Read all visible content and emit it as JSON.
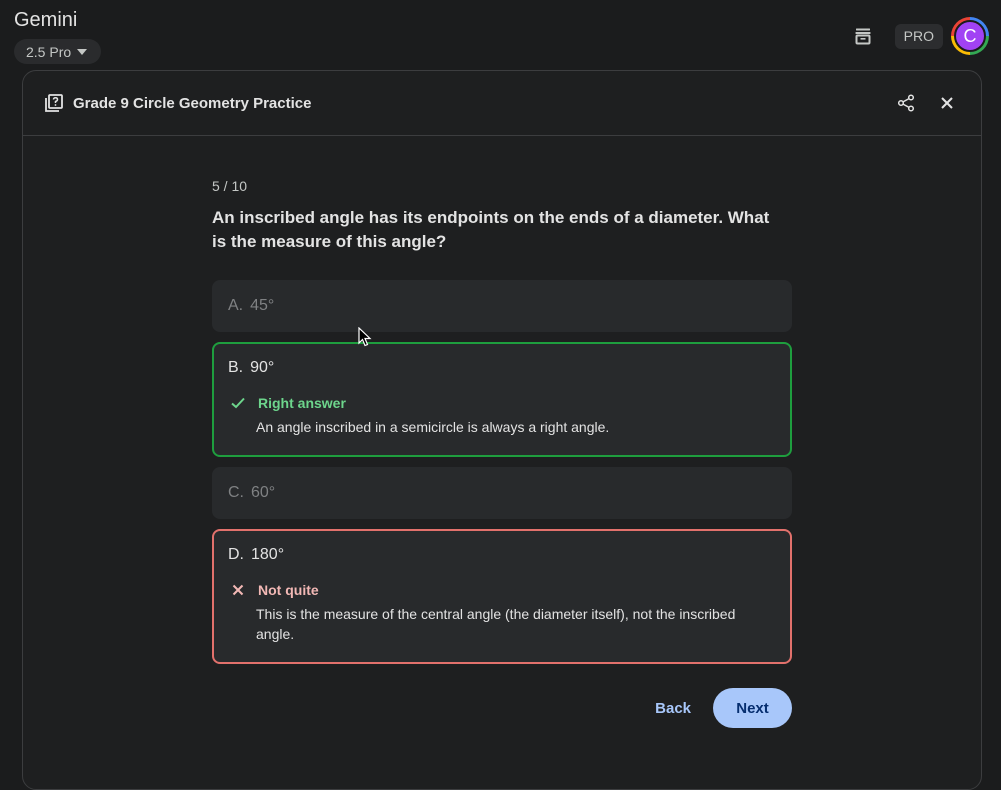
{
  "app": {
    "title": "Gemini",
    "model": "2.5 Pro",
    "pro_badge": "PRO",
    "avatar_letter": "C"
  },
  "panel": {
    "title": "Grade 9 Circle Geometry Practice"
  },
  "quiz": {
    "progress": "5 / 10",
    "question": "An inscribed angle has its endpoints on the ends of a diameter. What is the measure of this angle?",
    "options": [
      {
        "letter": "A.",
        "text": "45°"
      },
      {
        "letter": "B.",
        "text": "90°",
        "feedback_title": "Right answer",
        "feedback_text": "An angle inscribed in a semicircle is always a right angle."
      },
      {
        "letter": "C.",
        "text": "60°"
      },
      {
        "letter": "D.",
        "text": "180°",
        "feedback_title": "Not quite",
        "feedback_text": "This is the measure of the central angle (the diameter itself), not the inscribed angle."
      }
    ],
    "back_label": "Back",
    "next_label": "Next"
  },
  "colors": {
    "correct": "#1e9e3e",
    "wrong": "#e2716c",
    "accent": "#a8c7fa",
    "avatar": "#a142f4"
  },
  "icons": [
    "archive-icon",
    "share-icon",
    "close-icon",
    "quiz-icon",
    "check-icon",
    "x-icon"
  ]
}
